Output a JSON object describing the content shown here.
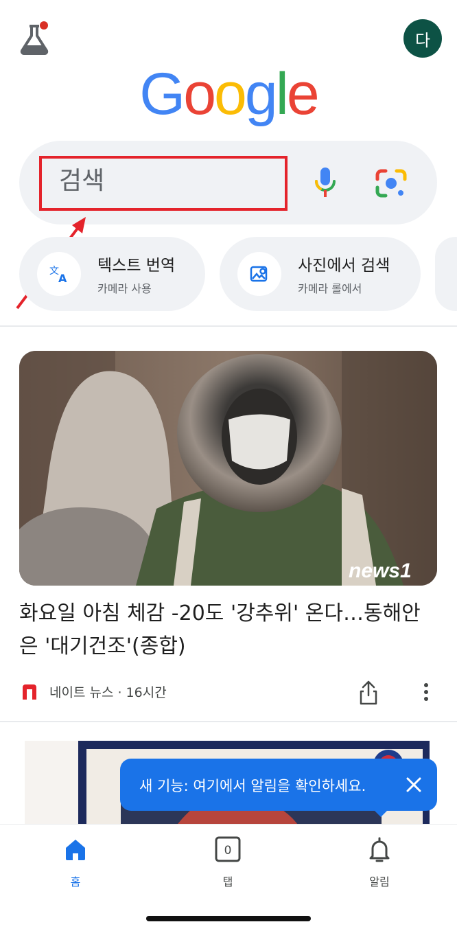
{
  "header": {
    "labs_icon": "flask-icon",
    "labs_badge_color": "#d93025",
    "avatar_letter": "다",
    "avatar_color": "#0d5245"
  },
  "logo": {
    "letters": [
      "G",
      "o",
      "o",
      "g",
      "l",
      "e"
    ],
    "colors": [
      "#4285f4",
      "#ea4335",
      "#fbbc05",
      "#4285f4",
      "#34a853",
      "#ea4335"
    ]
  },
  "search": {
    "placeholder": "검색",
    "mic_icon": "mic-icon",
    "lens_icon": "google-lens-icon",
    "highlight_color": "#e4232b"
  },
  "chips": [
    {
      "title": "텍스트 번역",
      "subtitle": "카메라 사용",
      "icon": "translate-icon"
    },
    {
      "title": "사진에서 검색",
      "subtitle": "카메라 롤에서",
      "icon": "image-search-icon"
    }
  ],
  "news": {
    "title": "화요일 아침 체감 -20도 '강추위' 온다…동해안은 '대기건조'(종합)",
    "source": "네이트 뉴스 · 16시간",
    "watermark": "news1",
    "share_icon": "share-icon",
    "more_icon": "more-vert-icon"
  },
  "toast": {
    "text": "새 기능: 여기에서 알림을 확인하세요.",
    "close_icon": "close-icon",
    "color": "#1a73e8"
  },
  "bottom_nav": {
    "home_label": "홈",
    "tabs_label": "탭",
    "tabs_count": "0",
    "alerts_label": "알림",
    "active_color": "#1a73e8"
  }
}
